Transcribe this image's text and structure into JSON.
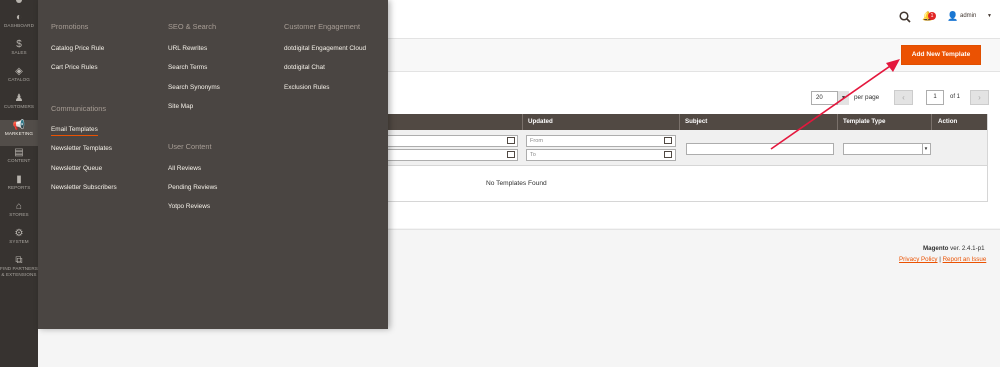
{
  "nav": {
    "items": [
      {
        "label": "DASHBOARD",
        "icon": "dashboard-icon",
        "glyph": "◐"
      },
      {
        "label": "SALES",
        "icon": "dollar-icon",
        "glyph": "$"
      },
      {
        "label": "CATALOG",
        "icon": "cube-icon",
        "glyph": "◈"
      },
      {
        "label": "CUSTOMERS",
        "icon": "person-icon",
        "glyph": "♟"
      },
      {
        "label": "MARKETING",
        "icon": "megaphone-icon",
        "glyph": "📢"
      },
      {
        "label": "CONTENT",
        "icon": "layout-icon",
        "glyph": "▤"
      },
      {
        "label": "REPORTS",
        "icon": "bar-chart-icon",
        "glyph": "▮"
      },
      {
        "label": "STORES",
        "icon": "store-icon",
        "glyph": "⌂"
      },
      {
        "label": "SYSTEM",
        "icon": "gear-icon",
        "glyph": "⚙"
      },
      {
        "label": "FIND PARTNERS & EXTENSIONS",
        "icon": "puzzle-icon",
        "glyph": "⧉"
      }
    ]
  },
  "menu": {
    "col1": {
      "heading1": "Promotions",
      "items1": [
        "Catalog Price Rule",
        "Cart Price Rules"
      ],
      "heading2": "Communications",
      "items2": [
        "Email Templates",
        "Newsletter Templates",
        "Newsletter Queue",
        "Newsletter Subscribers"
      ]
    },
    "col2": {
      "heading1": "SEO & Search",
      "items1": [
        "URL Rewrites",
        "Search Terms",
        "Search Synonyms",
        "Site Map"
      ],
      "heading2": "User Content",
      "items2": [
        "All Reviews",
        "Pending Reviews",
        "Yotpo Reviews"
      ]
    },
    "col3": {
      "heading1": "Customer Engagement",
      "items1": [
        "dotdigital Engagement Cloud",
        "dotdigital Chat",
        "Exclusion Rules"
      ]
    }
  },
  "header": {
    "notifications_count": "1",
    "user": "admin"
  },
  "actions": {
    "add_label": "Add New Template"
  },
  "pager": {
    "per_page": "20",
    "per_page_label": "per page",
    "page": "1",
    "of_label": "of 1"
  },
  "grid": {
    "columns": [
      "Updated",
      "Subject",
      "Template Type",
      "Action"
    ],
    "from_placeholder": "From",
    "to_placeholder": "To",
    "empty": "No Templates Found"
  },
  "footer": {
    "brand": "Magento",
    "version": "ver. 2.4.1-p1",
    "privacy": "Privacy Policy",
    "separator": "|",
    "report": "Report an Issue"
  },
  "colors": {
    "accent": "#eb5202",
    "nav_bg": "#373330",
    "flyout_bg": "#4a4542",
    "table_header": "#514943",
    "arrow": "#e4173d"
  }
}
